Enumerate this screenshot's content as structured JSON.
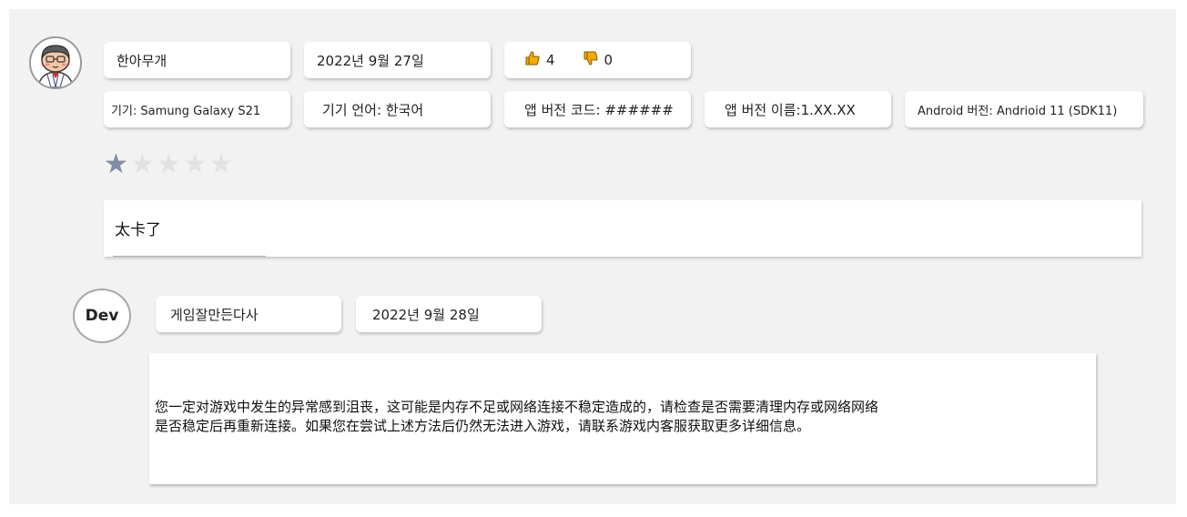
{
  "review": {
    "author": "한아무개",
    "date": "2022년 9월 27일",
    "likes": "4",
    "dislikes": "0",
    "device": "기기: Samung Galaxy S21",
    "language": "기기 언어: 한국어",
    "app_version_code": "앱 버전 코드: ######",
    "app_version_name": "앱 버전 이름:1.XX.XX",
    "android_version": "Android 버전: Andrioid 11 (SDK11)",
    "rating": 1,
    "rating_max": 5,
    "text": "太卡了"
  },
  "reply": {
    "badge": "Dev",
    "author": "게임잘만든다사",
    "date": "2022년 9월 28일",
    "line1": "您一定对游戏中发生的异常感到沮丧，这可能是内存不足或网络连接不稳定造成的，请检查是否需要清理内存或网络网络",
    "line2": "是否稳定后再重新连接。如果您在尝试上述方法后仍然无法进入游戏，请联系游戏内客服获取更多详细信息。"
  },
  "colors": {
    "thumb_up": "#f2a900",
    "thumb_down": "#f2a900",
    "star_active": "#7e8ea6",
    "star_inactive": "#e2e2e2"
  }
}
